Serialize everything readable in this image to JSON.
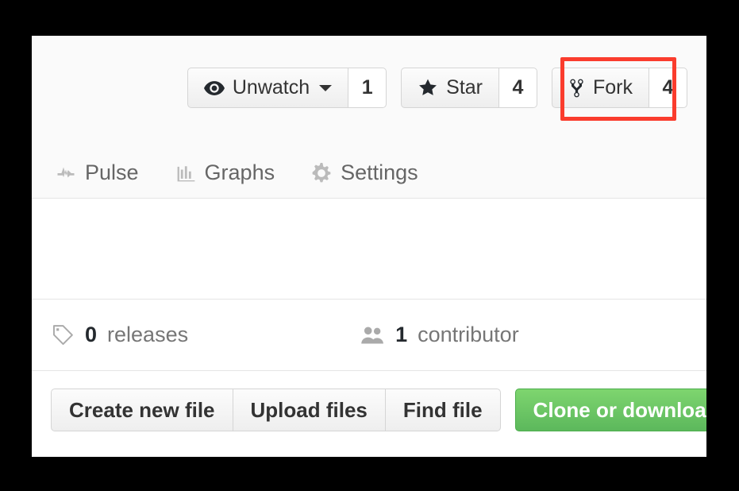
{
  "repo_actions": [
    {
      "id": "watch",
      "label": "Unwatch",
      "icon": "eye-icon",
      "count": "1",
      "has_caret": true,
      "highlighted": false
    },
    {
      "id": "star",
      "label": "Star",
      "icon": "star-icon",
      "count": "4",
      "has_caret": false,
      "highlighted": false
    },
    {
      "id": "fork",
      "label": "Fork",
      "icon": "fork-icon",
      "count": "4",
      "has_caret": false,
      "highlighted": true
    }
  ],
  "nav": {
    "items": [
      {
        "id": "pulse",
        "label": "Pulse",
        "icon": "pulse-icon"
      },
      {
        "id": "graphs",
        "label": "Graphs",
        "icon": "bar-chart-icon"
      },
      {
        "id": "settings",
        "label": "Settings",
        "icon": "gear-icon"
      }
    ]
  },
  "summary": {
    "releases": {
      "count": "0",
      "label": "releases",
      "icon": "tag-icon"
    },
    "contributors": {
      "count": "1",
      "label": "contributor",
      "icon": "people-icon"
    }
  },
  "file_actions": {
    "buttons": [
      {
        "id": "create-new-file",
        "label": "Create new file"
      },
      {
        "id": "upload-files",
        "label": "Upload files"
      },
      {
        "id": "find-file",
        "label": "Find file"
      }
    ],
    "primary": {
      "id": "clone-or-download",
      "label": "Clone or download",
      "has_caret": true
    }
  },
  "annotation": {
    "type": "rectangle",
    "target": "fork-button",
    "color": "#fa3c2d"
  },
  "colors": {
    "page_bg": "#ffffff",
    "header_bg": "#fafafa",
    "border": "#e5e5e5",
    "button_border": "#d5d5d5",
    "text": "#333333",
    "muted_text": "#767676",
    "green_top": "#7ed56f",
    "green_bottom": "#5cb85c",
    "highlight": "#fa3c2d"
  }
}
